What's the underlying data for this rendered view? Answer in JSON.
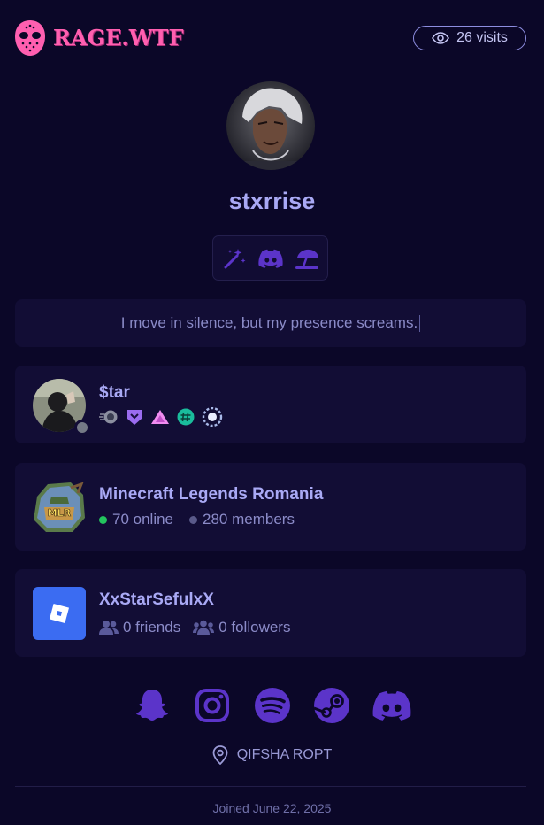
{
  "brand": {
    "name": "RAGE.WTF",
    "logo_icon": "hockey-mask-icon",
    "color": "#ff5fb0"
  },
  "visits": {
    "icon": "eye-icon",
    "label": "26 visits"
  },
  "profile": {
    "avatar": "profile-avatar",
    "username": "stxrrise",
    "badges": [
      "magic-wand-icon",
      "discord-icon",
      "beach-umbrella-icon"
    ],
    "bio": "I move in silence, but my presence screams."
  },
  "discord_card": {
    "name": "$tar",
    "status": "offline",
    "status_color": "#757a86",
    "badges": [
      "nitro-boost-icon",
      "hypesquad-icon",
      "triangle-badge-icon",
      "hashtag-badge-icon",
      "laurel-badge-icon"
    ]
  },
  "server_card": {
    "name": "Minecraft Legends Romania",
    "icon_text": "MLR",
    "online": "70 online",
    "members": "280 members",
    "online_color": "#23c55e",
    "members_color": "#5a5a8a"
  },
  "roblox_card": {
    "name": "XxStarSefulxX",
    "friends": "0 friends",
    "followers": "0 followers",
    "accent": "#3b6cf2"
  },
  "socials": [
    "snapchat-icon",
    "instagram-icon",
    "spotify-icon",
    "steam-icon",
    "discord-icon"
  ],
  "location": {
    "icon": "map-pin-icon",
    "label": "QIFSHA ROPT"
  },
  "joined": "Joined June 22, 2025",
  "colors": {
    "background": "#0b0728",
    "card": "#120d35",
    "accent": "#a9a9f5",
    "icon": "#5b34c9"
  }
}
